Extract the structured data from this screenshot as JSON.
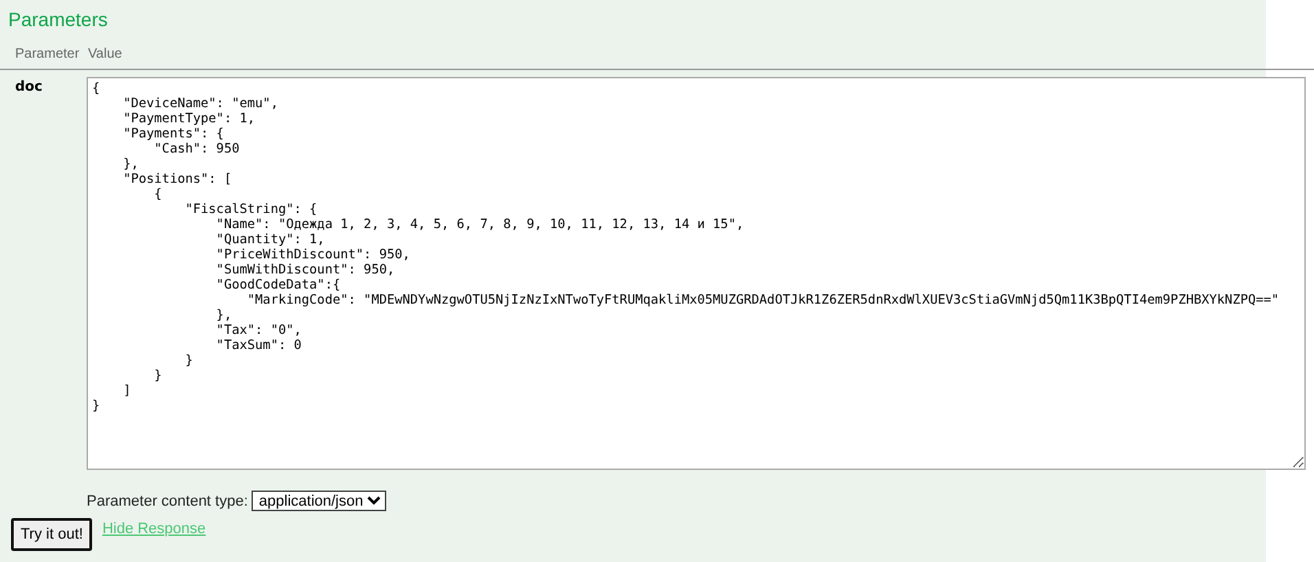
{
  "section_title": "Parameters",
  "columns": [
    "Parameter",
    "Value"
  ],
  "parameter": {
    "name": "doc",
    "value": "{\n    \"DeviceName\": \"emu\",\n    \"PaymentType\": 1,\n    \"Payments\": {\n        \"Cash\": 950\n    },\n    \"Positions\": [\n        {\n            \"FiscalString\": {\n                \"Name\": \"Одежда 1, 2, 3, 4, 5, 6, 7, 8, 9, 10, 11, 12, 13, 14 и 15\",\n                \"Quantity\": 1,\n                \"PriceWithDiscount\": 950,\n                \"SumWithDiscount\": 950,\n                \"GoodCodeData\":{\n                    \"MarkingCode\": \"MDEwNDYwNzgwOTU5NjIzNzIxNTwoTyFtRUMqakliMx05MUZGRDAdOTJkR1Z6ZER5dnRxdWlXUEV3cStiaGVmNjd5Qm11K3BpQTI4em9PZHBXYkNZPQ==\"\n                },\n                \"Tax\": \"0\",\n                \"TaxSum\": 0\n            }\n        }\n    ]\n}"
  },
  "content_type": {
    "label": "Parameter content type:",
    "value": "application/json"
  },
  "try_button": "Try it out!",
  "hide_link": "Hide Response"
}
